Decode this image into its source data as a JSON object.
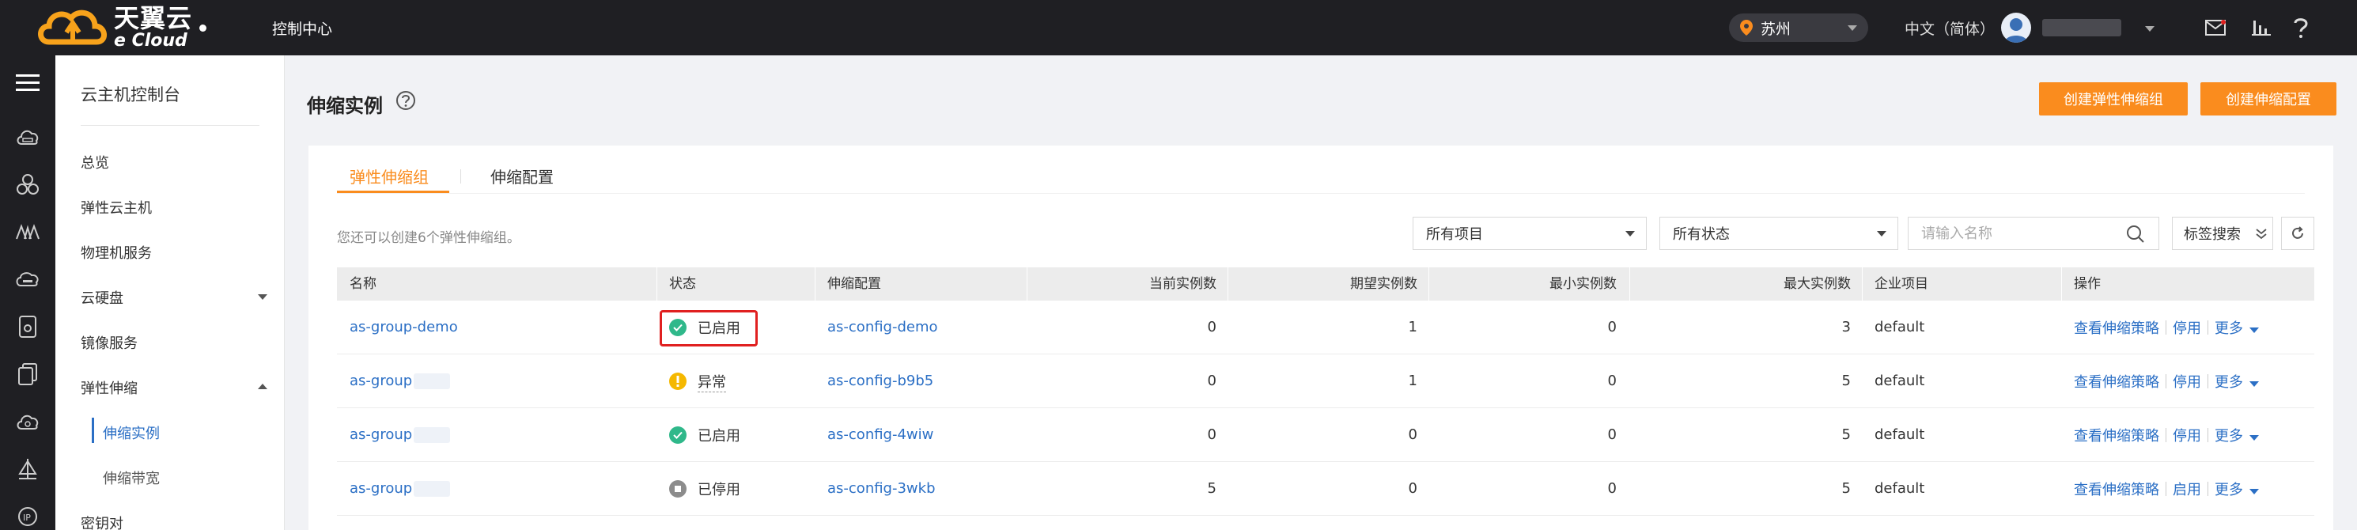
{
  "header": {
    "logo_cn": "天翼云",
    "logo_en": "e Cloud",
    "console": "控制中心",
    "region": "苏州",
    "language": "中文（简体）"
  },
  "sidebar": {
    "title": "云主机控制台",
    "items": [
      {
        "label": "总览"
      },
      {
        "label": "弹性云主机"
      },
      {
        "label": "物理机服务"
      },
      {
        "label": "云硬盘"
      },
      {
        "label": "镜像服务"
      },
      {
        "label": "弹性伸缩"
      },
      {
        "label": "伸缩实例"
      },
      {
        "label": "伸缩带宽"
      },
      {
        "label": "密钥对"
      }
    ]
  },
  "page": {
    "title": "伸缩实例",
    "create_group": "创建弹性伸缩组",
    "create_config": "创建伸缩配置"
  },
  "tabs": [
    {
      "label": "弹性伸缩组"
    },
    {
      "label": "伸缩配置"
    }
  ],
  "toolbar": {
    "hint": "您还可以创建6个弹性伸缩组。",
    "project_select": "所有项目",
    "status_select": "所有状态",
    "search_placeholder": "请输入名称",
    "tag_search": "标签搜索"
  },
  "table": {
    "columns": [
      "名称",
      "状态",
      "伸缩配置",
      "当前实例数",
      "期望实例数",
      "最小实例数",
      "最大实例数",
      "企业项目",
      "操作"
    ],
    "rows": [
      {
        "name": "as-group-demo",
        "status": "已启用",
        "config": "as-config-demo",
        "current": "0",
        "desired": "1",
        "min": "0",
        "max": "3",
        "project": "default",
        "op1": "查看伸缩策略",
        "op2": "停用",
        "op3": "更多"
      },
      {
        "name": "as-group",
        "status": "异常",
        "config": "as-config-b9b5",
        "current": "0",
        "desired": "1",
        "min": "0",
        "max": "5",
        "project": "default",
        "op1": "查看伸缩策略",
        "op2": "停用",
        "op3": "更多"
      },
      {
        "name": "as-group",
        "status": "已启用",
        "config": "as-config-4wiw",
        "current": "0",
        "desired": "0",
        "min": "0",
        "max": "5",
        "project": "default",
        "op1": "查看伸缩策略",
        "op2": "停用",
        "op3": "更多"
      },
      {
        "name": "as-group",
        "status": "已停用",
        "config": "as-config-3wkb",
        "current": "5",
        "desired": "0",
        "min": "0",
        "max": "5",
        "project": "default",
        "op1": "查看伸缩策略",
        "op2": "启用",
        "op3": "更多"
      }
    ]
  },
  "colors": {
    "accent": "#fa8c1e",
    "link": "#2b6fc5",
    "status_enabled": "#2fb88a",
    "status_error": "#f5b800",
    "status_stopped": "#8c8c8c",
    "highlight": "#e02020"
  }
}
